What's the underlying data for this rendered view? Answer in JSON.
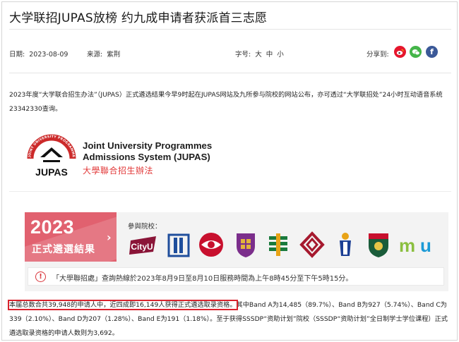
{
  "article": {
    "headline": "大学联招JUPAS放榜 约九成申请者获派首三志愿",
    "date_label": "日期:",
    "date": "2023-08-09",
    "source_label": "来源:",
    "source": "紫荆",
    "size_label": "字号:",
    "size_options": [
      "大",
      "中",
      "小"
    ],
    "share_label": "分享到:",
    "para1": "2023年度“大学联合招生办法”（JUPAS）正式遴选结果今早9时起在JUPAS网站及九所参与院校的网站公布，亦可透过“大学联招处”24小时互动语音系统23342330查询。",
    "para2_highlight": "本届总数合共39,948的申请人中，近四成即16,149人获得正式遴选取录资格。",
    "para2_rest": "其中Band A为14,485（89.7%）、Band B为927（5.74%）、Band C为339（2.10%）、Band D为207（1.28%）、Band E为191（1.18%）。至于获得SSSDP“资助计划”院校（SSSDP“资助计划”全日制学士学位课程）正式遴选取录资格的申请人数则为3,692。"
  },
  "logo": {
    "mark_text": "JUPAS",
    "ring_text": "JOINT UNIVERSITY PROGRAMMES ADMISSIONS SYSTEM",
    "line1": "Joint University Programmes",
    "line2": "Admissions System (JUPAS)",
    "cn": "大學聯合招生辦法"
  },
  "banner": {
    "year": "2023",
    "subtitle": "正式遴選結果",
    "institutions_label": "參與院校：",
    "institutions": [
      "CityU",
      "EdUHK",
      "HKBU",
      "CUHK",
      "HKUST",
      "PolyU",
      "LU",
      "HKU",
      "HKMU"
    ],
    "notice": "「大學聯招處」查詢熱線於2023年8月9日至8月10日服務時間為上午8時45分至下午5時15分。"
  },
  "colors": {
    "accent_red": "#e1616f",
    "highlight_box": "#d9232d",
    "weibo": "#e6162d",
    "wechat": "#44b549",
    "facebook": "#3b5998"
  }
}
